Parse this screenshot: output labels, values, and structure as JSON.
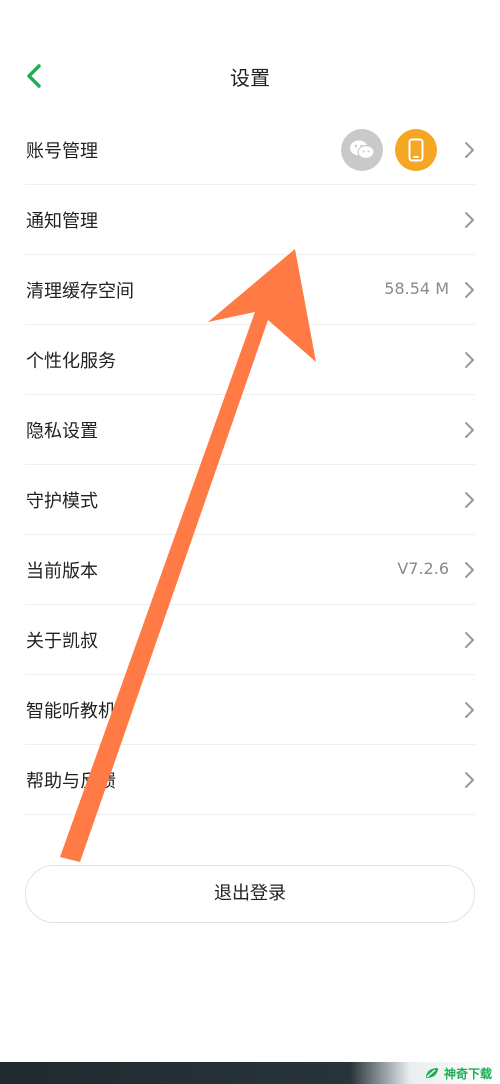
{
  "header": {
    "title": "设置"
  },
  "list": [
    {
      "label": "账号管理",
      "value": ""
    },
    {
      "label": "通知管理",
      "value": ""
    },
    {
      "label": "清理缓存空间",
      "value": "58.54 M"
    },
    {
      "label": "个性化服务",
      "value": ""
    },
    {
      "label": "隐私设置",
      "value": ""
    },
    {
      "label": "守护模式",
      "value": ""
    },
    {
      "label": "当前版本",
      "value": "V7.2.6"
    },
    {
      "label": "关于凯叔",
      "value": ""
    },
    {
      "label": "智能听教机",
      "value": ""
    },
    {
      "label": "帮助与反馈",
      "value": ""
    }
  ],
  "account_icons": [
    "wechat-icon",
    "phone-icon"
  ],
  "logout_label": "退出登录",
  "watermark_text": "神奇下载",
  "colors": {
    "accent_green": "#1fae55",
    "phone_orange": "#f5a623",
    "wechat_gray": "#c9c9c9",
    "annotation_arrow": "#ff7a45"
  }
}
